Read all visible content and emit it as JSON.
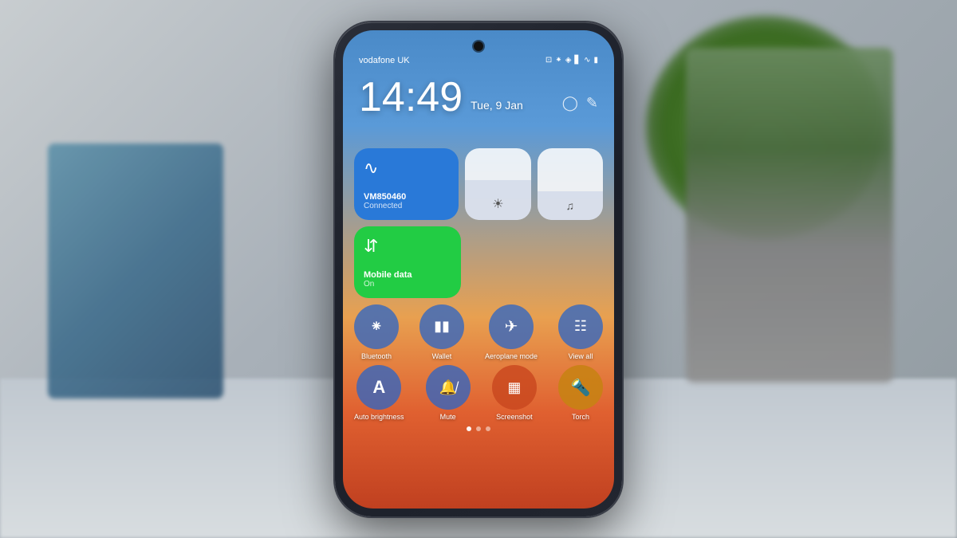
{
  "scene": {
    "background_desc": "blurred desk scene with blue storage box and plant in metal pot"
  },
  "phone": {
    "status_bar": {
      "carrier": "vodafone UK",
      "icons": [
        "sim-icon",
        "bluetooth-icon",
        "nfc-icon",
        "signal-icon",
        "wifi-icon",
        "battery-icon"
      ]
    },
    "time": "14:49",
    "date": "Tue, 9 Jan",
    "right_icons": [
      "brightness-icon",
      "edit-icon"
    ],
    "tiles": {
      "wifi": {
        "name": "VM850460",
        "status": "Connected",
        "icon": "wifi"
      },
      "mobile_data": {
        "name": "Mobile data",
        "status": "On",
        "icon": "mobile-data"
      },
      "brightness_label": "☀",
      "volume_label": "♪"
    },
    "quick_buttons_row1": [
      {
        "id": "bluetooth",
        "label": "Bluetooth",
        "icon": "bluetooth"
      },
      {
        "id": "wallet",
        "label": "Wallet",
        "icon": "wallet"
      },
      {
        "id": "aeroplane",
        "label": "Aeroplane mode",
        "icon": "airplane"
      },
      {
        "id": "view-all",
        "label": "View all",
        "icon": "grid"
      }
    ],
    "quick_buttons_row2": [
      {
        "id": "auto-brightness",
        "label": "Auto brightness",
        "icon": "A"
      },
      {
        "id": "mute",
        "label": "Mute",
        "icon": "mute"
      },
      {
        "id": "screenshot",
        "label": "Screenshot",
        "icon": "screenshot"
      },
      {
        "id": "torch",
        "label": "Torch",
        "icon": "torch"
      }
    ],
    "dots": [
      {
        "active": true
      },
      {
        "active": false
      },
      {
        "active": false
      }
    ]
  }
}
